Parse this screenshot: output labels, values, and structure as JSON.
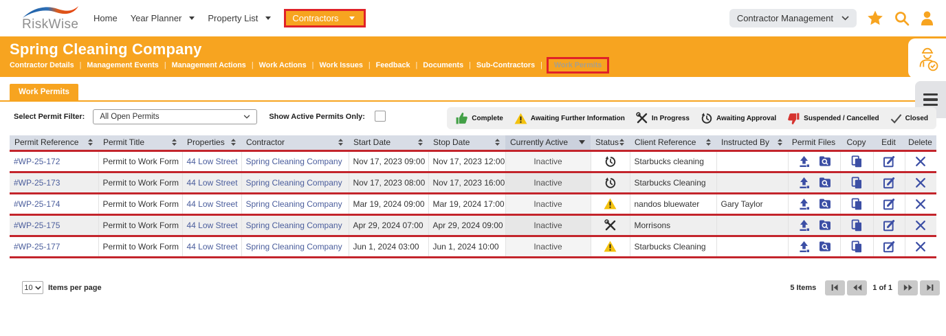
{
  "colors": {
    "accent": "#f7a420",
    "row_divider": "#c3242b",
    "annotation": "#e02128",
    "link": "#4a5d9c",
    "action_icon": "#3c4fa5",
    "complete_green": "#43a047",
    "warning_yellow": "#f4c20e",
    "suspended_red": "#d6332f"
  },
  "nav": {
    "logo_text": "RiskWise",
    "items": [
      {
        "label": "Home",
        "caret": false,
        "highlighted": false
      },
      {
        "label": "Year Planner",
        "caret": true,
        "highlighted": false
      },
      {
        "label": "Property List",
        "caret": true,
        "highlighted": false
      },
      {
        "label": "Contractors",
        "caret": true,
        "highlighted": true
      }
    ],
    "module_select": "Contractor Management"
  },
  "header": {
    "title": "Spring Cleaning Company",
    "tabs": [
      "Contractor Details",
      "Management Events",
      "Management Actions",
      "Work Actions",
      "Work Issues",
      "Feedback",
      "Documents",
      "Sub-Contractors",
      "Work Permits"
    ],
    "active_tab": "Work Permits"
  },
  "toolbar": {
    "tab_label": "Work Permits",
    "filter_label": "Select Permit Filter:",
    "filter_value": "All Open Permits",
    "active_only_label": "Show Active Permits Only:",
    "active_only_checked": false
  },
  "legend": {
    "items": [
      {
        "icon": "thumbs-up",
        "label": "Complete"
      },
      {
        "icon": "warning-triangle",
        "label": "Awaiting Further Information"
      },
      {
        "icon": "crossed-tools",
        "label": "In Progress"
      },
      {
        "icon": "history-clock",
        "label": "Awaiting Approval"
      },
      {
        "icon": "thumbs-down",
        "label": "Suspended / Cancelled"
      },
      {
        "icon": "check",
        "label": "Closed"
      }
    ]
  },
  "table": {
    "columns": [
      {
        "label": "Permit Reference",
        "sort": "both"
      },
      {
        "label": "Permit Title",
        "sort": "both"
      },
      {
        "label": "Properties",
        "sort": "both"
      },
      {
        "label": "Contractor",
        "sort": "both"
      },
      {
        "label": "Start Date",
        "sort": "both"
      },
      {
        "label": "Stop Date",
        "sort": "both"
      },
      {
        "label": "Currently Active",
        "sort": "down"
      },
      {
        "label": "Status",
        "sort": "both"
      },
      {
        "label": "Client Reference",
        "sort": "both"
      },
      {
        "label": "Instructed By",
        "sort": "both"
      },
      {
        "label": "Permit Files",
        "sort": null
      },
      {
        "label": "Copy",
        "sort": null
      },
      {
        "label": "Edit",
        "sort": null
      },
      {
        "label": "Delete",
        "sort": null
      }
    ],
    "rows": [
      {
        "ref": "#WP-25-172",
        "title": "Permit to Work Form",
        "property": "44 Low Street",
        "contractor": "Spring Cleaning Company",
        "start": "Nov 17, 2023 09:00",
        "stop": "Nov 17, 2023 12:00",
        "active": "Inactive",
        "status": "awaiting-approval",
        "client": "Starbucks cleaning",
        "instructed_by": ""
      },
      {
        "ref": "#WP-25-173",
        "title": "Permit to Work Form",
        "property": "44 Low Street",
        "contractor": "Spring Cleaning Company",
        "start": "Nov 17, 2023 08:00",
        "stop": "Nov 17, 2023 16:00",
        "active": "Inactive",
        "status": "awaiting-approval",
        "client": "Starbucks Cleaning",
        "instructed_by": ""
      },
      {
        "ref": "#WP-25-174",
        "title": "Permit to Work Form",
        "property": "44 Low Street",
        "contractor": "Spring Cleaning Company",
        "start": "Mar 19, 2024 09:00",
        "stop": "Mar 19, 2024 17:00",
        "active": "Inactive",
        "status": "awaiting-info",
        "client": "nandos bluewater",
        "instructed_by": "Gary Taylor"
      },
      {
        "ref": "#WP-25-175",
        "title": "Permit to Work Form",
        "property": "44 Low Street",
        "contractor": "Spring Cleaning Company",
        "start": "Apr 29, 2024 07:00",
        "stop": "Apr 29, 2024 09:00",
        "active": "Inactive",
        "status": "in-progress",
        "client": "Morrisons",
        "instructed_by": ""
      },
      {
        "ref": "#WP-25-177",
        "title": "Permit to Work Form",
        "property": "44 Low Street",
        "contractor": "Spring Cleaning Company",
        "start": "Jun 1, 2024 03:00",
        "stop": "Jun 1, 2024 10:00",
        "active": "Inactive",
        "status": "awaiting-info",
        "client": "Starbucks Cleaning",
        "instructed_by": ""
      }
    ]
  },
  "footer": {
    "page_size": "10",
    "items_per_page_label": "Items per page",
    "items_count": "5 Items",
    "page_info": "1 of 1"
  }
}
